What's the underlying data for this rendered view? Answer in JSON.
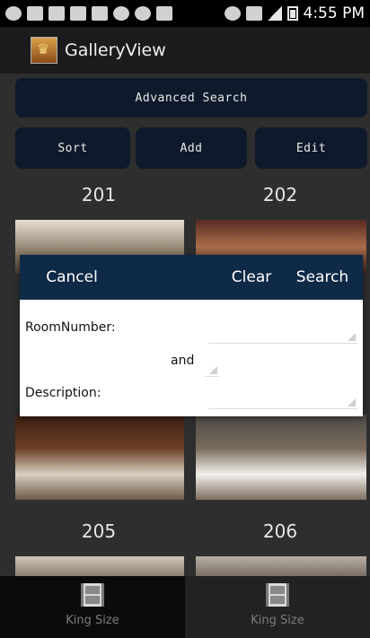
{
  "status": {
    "time": "4:55 PM"
  },
  "app": {
    "title": "GalleryView"
  },
  "toolbar": {
    "advanced_search_label": "Advanced Search",
    "sort_label": "Sort",
    "add_label": "Add",
    "edit_label": "Edit"
  },
  "gallery": {
    "rows": [
      {
        "left": "201",
        "right": "202"
      },
      {
        "left": "205",
        "right": "206"
      }
    ]
  },
  "dialog": {
    "cancel_label": "Cancel",
    "clear_label": "Clear",
    "search_label": "Search",
    "room_number_label": "RoomNumber:",
    "and_label": "and",
    "description_label": "Description:"
  },
  "tabs": [
    {
      "label": "King Size"
    },
    {
      "label": "King Size"
    }
  ]
}
